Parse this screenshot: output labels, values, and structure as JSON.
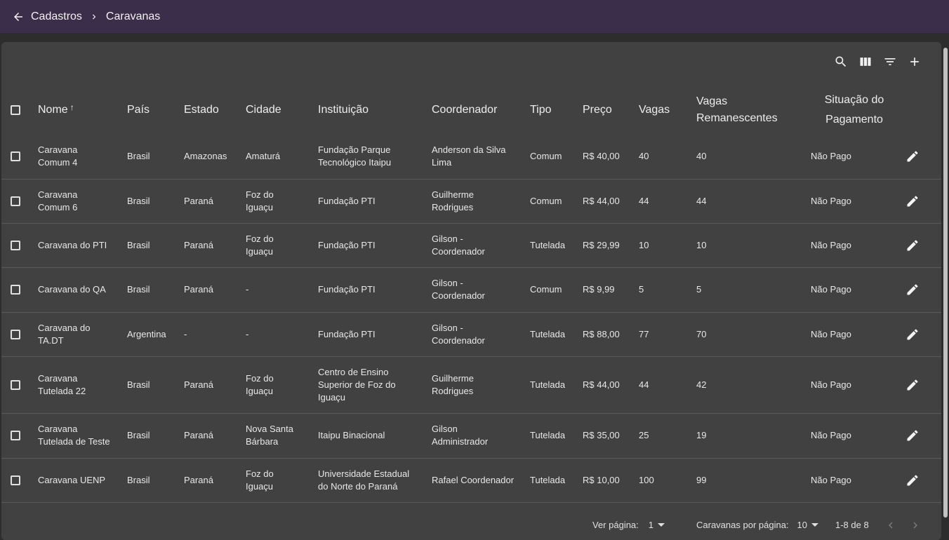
{
  "breadcrumb": {
    "parent": "Cadastros",
    "current": "Caravanas"
  },
  "headers": {
    "nome": "Nome",
    "pais": "País",
    "estado": "Estado",
    "cidade": "Cidade",
    "instituicao": "Instituição",
    "coordenador": "Coordenador",
    "tipo": "Tipo",
    "preco": "Preço",
    "vagas": "Vagas",
    "vagas_rem_1": "Vagas",
    "vagas_rem_2": "Remanescentes",
    "pag_1": "Situação do",
    "pag_2": "Pagamento",
    "sort_icon": "↑"
  },
  "rows": [
    {
      "nome_1": "Caravana",
      "nome_2": "Comum 4",
      "pais": "Brasil",
      "estado": "Amazonas",
      "cidade_1": "Amaturá",
      "cidade_2": "",
      "inst_1": "Fundação Parque",
      "inst_2": "Tecnológico Itaipu",
      "inst_3": "",
      "coord_1": "Anderson da Silva",
      "coord_2": "Lima",
      "tipo": "Comum",
      "preco": "R$ 40,00",
      "vagas": "40",
      "rem": "40",
      "sit": "Não Pago"
    },
    {
      "nome_1": "Caravana",
      "nome_2": "Comum 6",
      "pais": "Brasil",
      "estado": "Paraná",
      "cidade_1": "Foz do",
      "cidade_2": "Iguaçu",
      "inst_1": "Fundação PTI",
      "inst_2": "",
      "inst_3": "",
      "coord_1": "Guilherme",
      "coord_2": "Rodrigues",
      "tipo": "Comum",
      "preco": "R$ 44,00",
      "vagas": "44",
      "rem": "44",
      "sit": "Não Pago"
    },
    {
      "nome_1": "Caravana do PTI",
      "nome_2": "",
      "pais": "Brasil",
      "estado": "Paraná",
      "cidade_1": "Foz do",
      "cidade_2": "Iguaçu",
      "inst_1": "Fundação PTI",
      "inst_2": "",
      "inst_3": "",
      "coord_1": "Gilson -",
      "coord_2": "Coordenador",
      "tipo": "Tutelada",
      "preco": "R$ 29,99",
      "vagas": "10",
      "rem": "10",
      "sit": "Não Pago"
    },
    {
      "nome_1": "Caravana do QA",
      "nome_2": "",
      "pais": "Brasil",
      "estado": "Paraná",
      "cidade_1": "-",
      "cidade_2": "",
      "inst_1": "Fundação PTI",
      "inst_2": "",
      "inst_3": "",
      "coord_1": "Gilson -",
      "coord_2": "Coordenador",
      "tipo": "Comum",
      "preco": "R$ 9,99",
      "vagas": "5",
      "rem": "5",
      "sit": "Não Pago"
    },
    {
      "nome_1": "Caravana do",
      "nome_2": "TA.DT",
      "pais": "Argentina",
      "estado": "-",
      "cidade_1": "-",
      "cidade_2": "",
      "inst_1": "Fundação PTI",
      "inst_2": "",
      "inst_3": "",
      "coord_1": "Gilson -",
      "coord_2": "Coordenador",
      "tipo": "Tutelada",
      "preco": "R$ 88,00",
      "vagas": "77",
      "rem": "70",
      "sit": "Não Pago"
    },
    {
      "nome_1": "Caravana",
      "nome_2": "Tutelada 22",
      "pais": "Brasil",
      "estado": "Paraná",
      "cidade_1": "Foz do",
      "cidade_2": "Iguaçu",
      "inst_1": "Centro de Ensino",
      "inst_2": "Superior de Foz do",
      "inst_3": "Iguaçu",
      "coord_1": "Guilherme",
      "coord_2": "Rodrigues",
      "tipo": "Tutelada",
      "preco": "R$ 44,00",
      "vagas": "44",
      "rem": "42",
      "sit": "Não Pago"
    },
    {
      "nome_1": "Caravana",
      "nome_2": "Tutelada de Teste",
      "pais": "Brasil",
      "estado": "Paraná",
      "cidade_1": "Nova Santa",
      "cidade_2": "Bárbara",
      "inst_1": "Itaipu Binacional",
      "inst_2": "",
      "inst_3": "",
      "coord_1": "Gilson",
      "coord_2": "Administrador",
      "tipo": "Tutelada",
      "preco": "R$ 35,00",
      "vagas": "25",
      "rem": "19",
      "sit": "Não Pago"
    },
    {
      "nome_1": "Caravana UENP",
      "nome_2": "",
      "pais": "Brasil",
      "estado": "Paraná",
      "cidade_1": "Foz do",
      "cidade_2": "Iguaçu",
      "inst_1": "Universidade Estadual",
      "inst_2": "do Norte do Paraná",
      "inst_3": "",
      "coord_1": "Rafael Coordenador",
      "coord_2": "",
      "tipo": "Tutelada",
      "preco": "R$ 10,00",
      "vagas": "100",
      "rem": "99",
      "sit": "Não Pago"
    }
  ],
  "footer": {
    "page_label": "Ver página:",
    "page_value": "1",
    "per_page_label": "Caravanas por página:",
    "per_page_value": "10",
    "range": "1-8 de 8"
  }
}
